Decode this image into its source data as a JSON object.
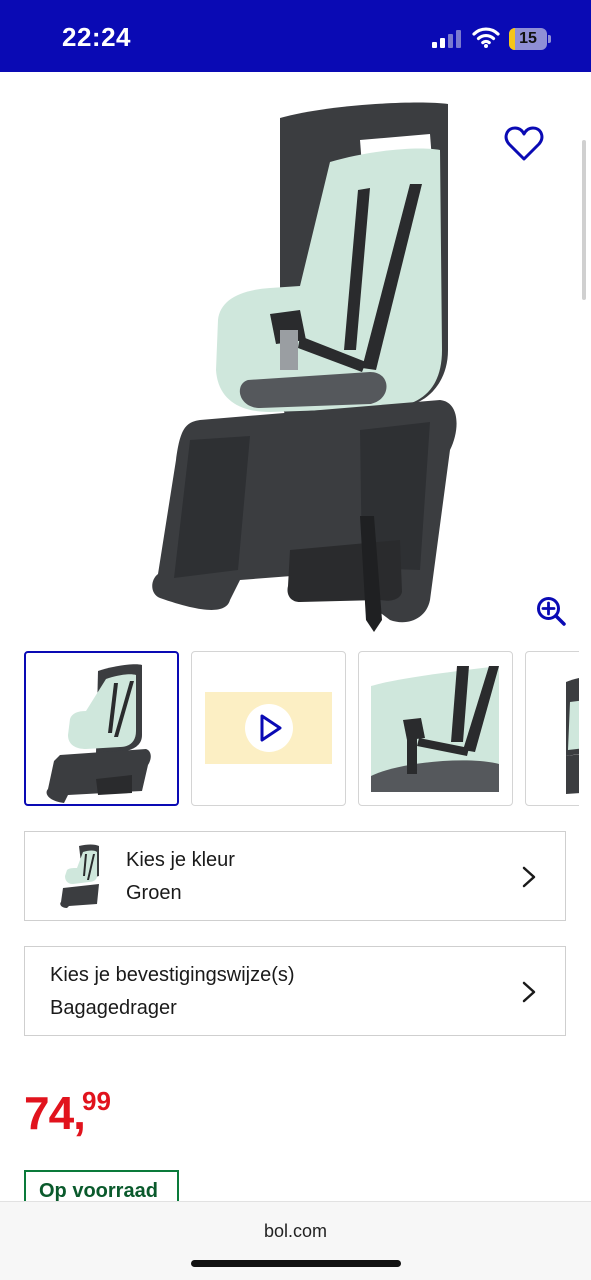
{
  "status_bar": {
    "time": "22:24",
    "battery_level": "15",
    "battery_fraction": 0.15,
    "icons": [
      "signal-icon",
      "wifi-icon",
      "battery-icon"
    ]
  },
  "product": {
    "image_alt": "fietsstoeltje",
    "gallery": [
      {
        "kind": "image"
      },
      {
        "kind": "video"
      },
      {
        "kind": "image"
      },
      {
        "kind": "image"
      }
    ],
    "selected_gallery_index": 0
  },
  "options": {
    "color": {
      "label": "Kies je kleur",
      "value": "Groen"
    },
    "mount": {
      "label": "Kies je bevestigingswijze(s)",
      "value": "Bagagedrager"
    }
  },
  "price": {
    "euros": "74",
    "separator": ",",
    "cents": "99",
    "color": "#e1131d"
  },
  "stock": {
    "label": "Op voorraad",
    "color": "#0a7a3a"
  },
  "browser": {
    "url": "bol.com"
  },
  "colors": {
    "brand": "#0a0ab4",
    "seat_mint": "#cfe7dc",
    "seat_dark": "#3b3d40"
  }
}
